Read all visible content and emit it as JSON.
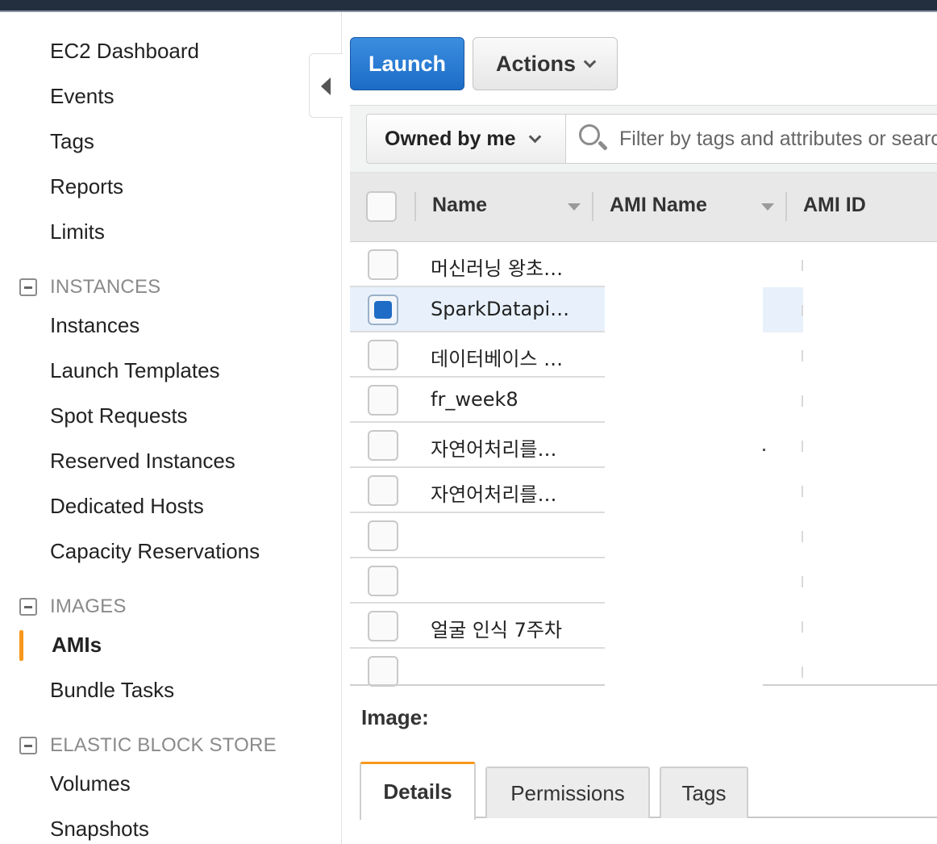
{
  "sidebar": {
    "items": [
      {
        "label": "EC2 Dashboard"
      },
      {
        "label": "Events"
      },
      {
        "label": "Tags"
      },
      {
        "label": "Reports"
      },
      {
        "label": "Limits"
      }
    ],
    "sections": [
      {
        "label": "INSTANCES",
        "items": [
          {
            "label": "Instances"
          },
          {
            "label": "Launch Templates"
          },
          {
            "label": "Spot Requests"
          },
          {
            "label": "Reserved Instances"
          },
          {
            "label": "Dedicated Hosts"
          },
          {
            "label": "Capacity Reservations"
          }
        ]
      },
      {
        "label": "IMAGES",
        "items": [
          {
            "label": "AMIs",
            "active": true
          },
          {
            "label": "Bundle Tasks"
          }
        ]
      },
      {
        "label": "ELASTIC BLOCK STORE",
        "items": [
          {
            "label": "Volumes"
          },
          {
            "label": "Snapshots"
          }
        ]
      }
    ]
  },
  "toolbar": {
    "launch_label": "Launch",
    "actions_label": "Actions"
  },
  "filter": {
    "owner_selected": "Owned by me",
    "search_placeholder": "Filter by tags and attributes or search by keyword"
  },
  "table": {
    "columns": [
      "Name",
      "AMI Name",
      "AMI ID"
    ],
    "rows": [
      {
        "name": "머신러닝 왕초…",
        "selected": false
      },
      {
        "name": "SparkDatapi…",
        "selected": true
      },
      {
        "name": "데이터베이스 …",
        "selected": false
      },
      {
        "name": "fr_week8",
        "selected": false
      },
      {
        "name": "자연어처리를…",
        "selected": false
      },
      {
        "name": "자연어처리를…",
        "selected": false
      },
      {
        "name": "",
        "selected": false
      },
      {
        "name": "",
        "selected": false
      },
      {
        "name": "얼굴 인식 7주차",
        "selected": false
      },
      {
        "name": "",
        "selected": false
      }
    ]
  },
  "details": {
    "image_label": "Image:",
    "tabs": [
      "Details",
      "Permissions",
      "Tags"
    ],
    "active_tab": "Details"
  },
  "colors": {
    "accent": "#f7981d",
    "primary_button": "#1c6cc6",
    "topbar": "#232f3e",
    "selected_row": "#e8f1fb"
  }
}
